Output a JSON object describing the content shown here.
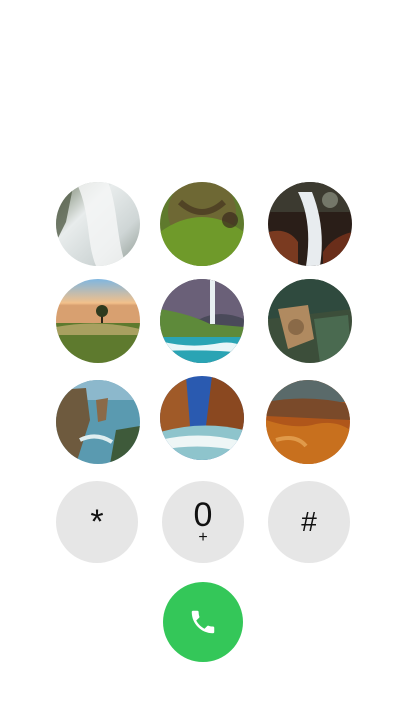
{
  "keypad": {
    "star_label": "*",
    "zero_label": "0",
    "zero_sub": "+",
    "hash_label": "#"
  },
  "images": [
    "waterfall-close-photo",
    "grassy-hill-swirl-photo",
    "forest-stream-photo",
    "lone-tree-sunset-photo",
    "coastal-waterfall-photo",
    "rocky-coast-trees-photo",
    "sea-cliffs-photo",
    "canyon-surf-photo",
    "orange-canyon-photo"
  ],
  "colors": {
    "call_green": "#34c759",
    "key_gray": "#e6e6e6",
    "background": "#ffffff"
  },
  "icons": {
    "call": "phone-icon"
  }
}
